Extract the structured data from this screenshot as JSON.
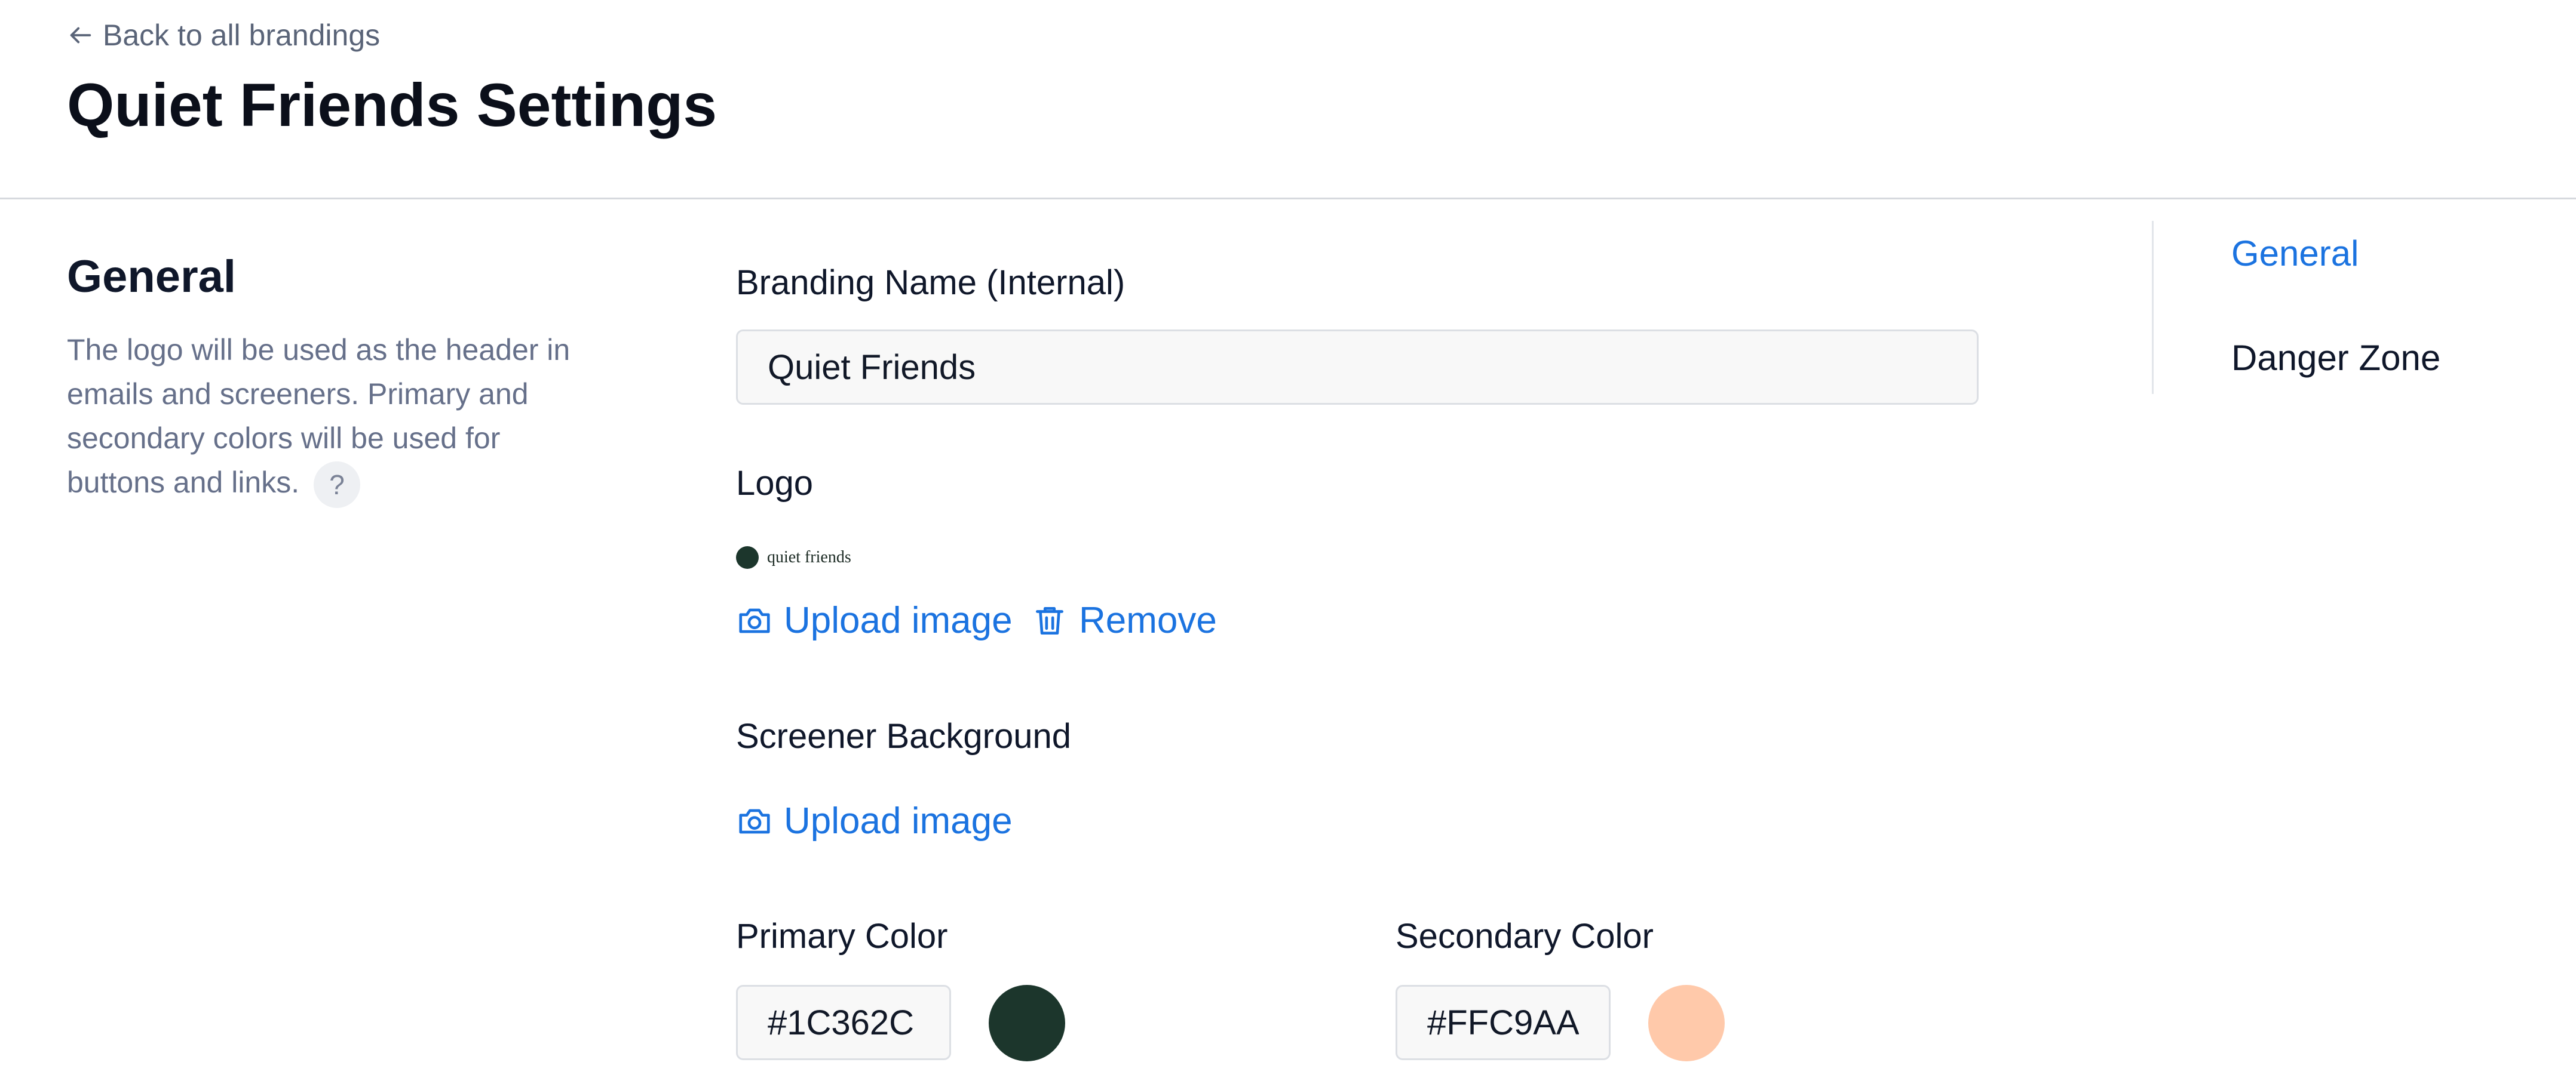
{
  "header": {
    "back_label": "Back to all brandings",
    "title": "Quiet Friends Settings"
  },
  "general": {
    "title": "General",
    "description": "The logo will be used as the header in emails and screeners. Primary and secondary colors will be used for buttons and links.",
    "help_icon": "?"
  },
  "form": {
    "branding_name_label": "Branding Name (Internal)",
    "branding_name_value": "Quiet Friends",
    "logo_label": "Logo",
    "logo_text": "quiet friends",
    "upload_image_label": "Upload image",
    "remove_label": "Remove",
    "screener_background_label": "Screener Background",
    "screener_upload_label": "Upload image",
    "primary_color_label": "Primary Color",
    "primary_color_value": "#1C362C",
    "secondary_color_label": "Secondary Color",
    "secondary_color_value": "#FFC9AA"
  },
  "nav": {
    "items": [
      {
        "label": "General",
        "active": true
      },
      {
        "label": "Danger Zone",
        "active": false
      }
    ]
  },
  "colors": {
    "accent": "#1b73e0",
    "primary_swatch": "#1c362c",
    "secondary_swatch": "#ffc9aa",
    "nav_active": "#1b73e0",
    "nav_inactive": "#0f172a"
  },
  "icons": [
    "arrow-left-icon",
    "help-icon",
    "camera-icon",
    "trash-icon"
  ]
}
